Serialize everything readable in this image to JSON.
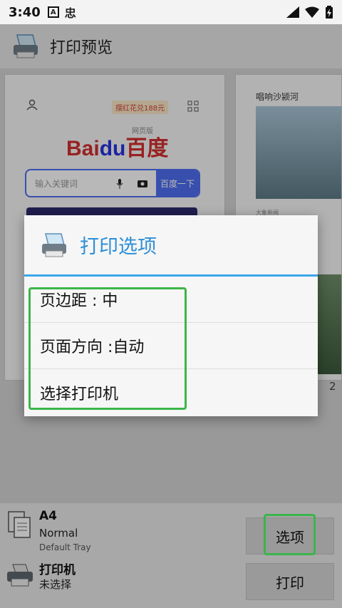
{
  "status_bar": {
    "time": "3:40",
    "icon_a_label": "A",
    "icon_b_label": "忠"
  },
  "app_bar": {
    "title": "打印预览"
  },
  "preview": {
    "promo_text": "摆红花兑188元",
    "baidu_logo_left": "Bai",
    "baidu_logo_du": "du",
    "baidu_logo_right": "百度",
    "baidu_sub": "网页版",
    "search_placeholder": "输入关键词",
    "search_button": "百度一下",
    "page2_title": "唱响沙颍河",
    "page2_caption": "大象新闻",
    "page_number": "2"
  },
  "dialog": {
    "title": "打印选项",
    "items": [
      {
        "label": "页边距 : 中"
      },
      {
        "label": "页面方向 :自动"
      },
      {
        "label": "选择打印机"
      }
    ]
  },
  "bottom": {
    "paper_size": "A4",
    "orientation": "Normal",
    "tray": "Default Tray",
    "printer_label": "打印机",
    "printer_status": "未选择",
    "options_button": "选项",
    "print_button": "打印"
  },
  "colors": {
    "accent": "#3aa6e8",
    "title_blue": "#2e8fd6",
    "highlight_green": "#3bb54a"
  }
}
